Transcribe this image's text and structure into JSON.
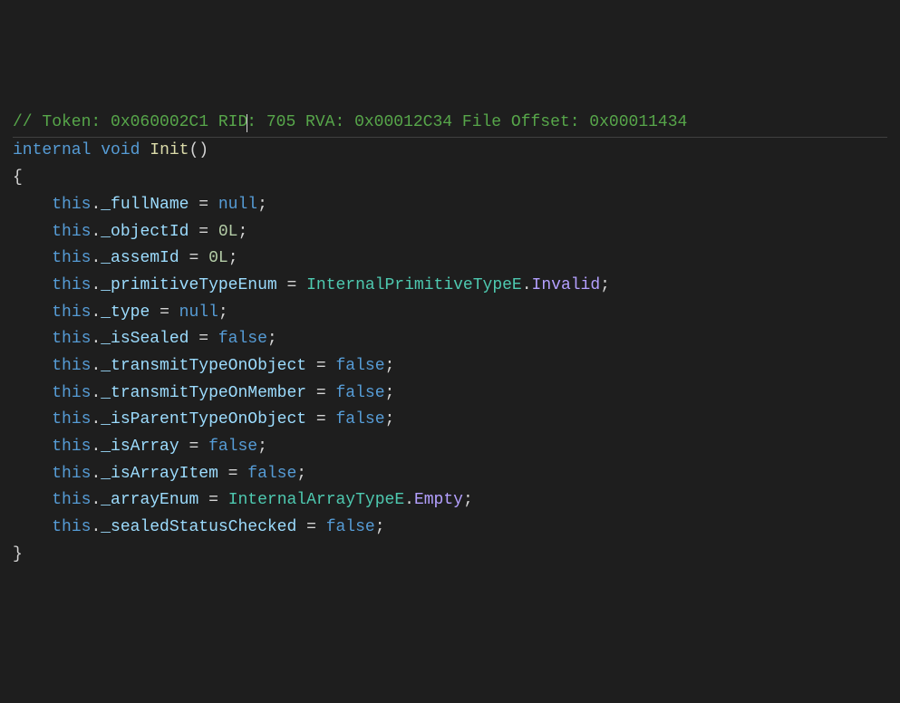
{
  "comment": {
    "token": "0x060002C1",
    "rid": "705",
    "rva": "0x00012C34",
    "fileOffset": "0x00011434"
  },
  "signature": {
    "modifier": "internal",
    "returnType": "void",
    "name": "Init"
  },
  "body": {
    "openBrace": "{",
    "closeBrace": "}",
    "lines": [
      {
        "field": "_fullName",
        "rhs": [
          {
            "t": "null",
            "v": "null"
          }
        ]
      },
      {
        "field": "_objectId",
        "rhs": [
          {
            "t": "num",
            "v": "0L"
          }
        ]
      },
      {
        "field": "_assemId",
        "rhs": [
          {
            "t": "num",
            "v": "0L"
          }
        ]
      },
      {
        "field": "_primitiveTypeEnum",
        "rhs": [
          {
            "t": "type",
            "v": "InternalPrimitiveTypeE"
          },
          {
            "t": "dot",
            "v": "."
          },
          {
            "t": "enum",
            "v": "Invalid"
          }
        ]
      },
      {
        "field": "_type",
        "rhs": [
          {
            "t": "null",
            "v": "null"
          }
        ]
      },
      {
        "field": "_isSealed",
        "rhs": [
          {
            "t": "bool",
            "v": "false"
          }
        ]
      },
      {
        "field": "_transmitTypeOnObject",
        "rhs": [
          {
            "t": "bool",
            "v": "false"
          }
        ]
      },
      {
        "field": "_transmitTypeOnMember",
        "rhs": [
          {
            "t": "bool",
            "v": "false"
          }
        ]
      },
      {
        "field": "_isParentTypeOnObject",
        "rhs": [
          {
            "t": "bool",
            "v": "false"
          }
        ]
      },
      {
        "field": "_isArray",
        "rhs": [
          {
            "t": "bool",
            "v": "false"
          }
        ]
      },
      {
        "field": "_isArrayItem",
        "rhs": [
          {
            "t": "bool",
            "v": "false"
          }
        ]
      },
      {
        "field": "_arrayEnum",
        "rhs": [
          {
            "t": "type",
            "v": "InternalArrayTypeE"
          },
          {
            "t": "dot",
            "v": "."
          },
          {
            "t": "enum",
            "v": "Empty"
          }
        ]
      },
      {
        "field": "_sealedStatusChecked",
        "rhs": [
          {
            "t": "bool",
            "v": "false"
          }
        ]
      }
    ]
  },
  "labels": {
    "tokenLabel": "Token:",
    "ridLabel": "RID",
    "rvaLabel": "RVA:",
    "fileOffsetLabel": "File Offset:",
    "this": "this",
    "eq": " = ",
    "semi": ";",
    "dot": ".",
    "parens": "()",
    "commentSlashes": "// ",
    "colon": ": "
  }
}
